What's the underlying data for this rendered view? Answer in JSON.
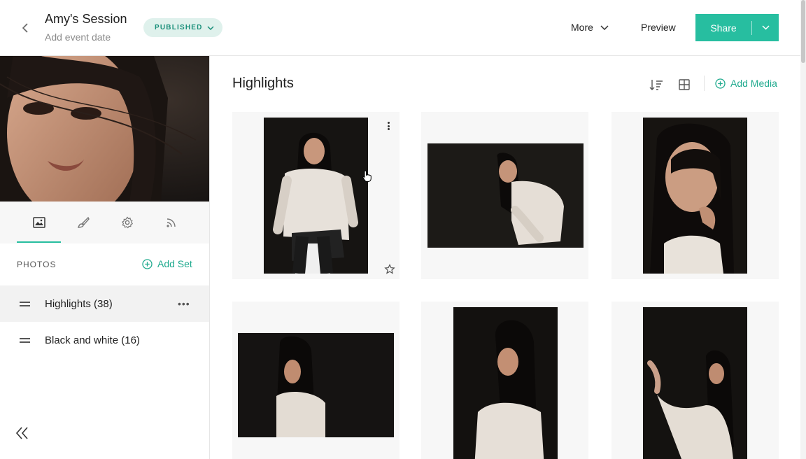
{
  "header": {
    "back_icon": "chevron-left-icon",
    "title": "Amy's Session",
    "subtitle": "Add event date",
    "status_label": "PUBLISHED",
    "more_label": "More",
    "preview_label": "Preview",
    "share_label": "Share"
  },
  "sidebar": {
    "tabs": [
      {
        "icon": "image-icon",
        "active": true
      },
      {
        "icon": "brush-icon",
        "active": false
      },
      {
        "icon": "gear-icon",
        "active": false
      },
      {
        "icon": "feed-icon",
        "active": false
      }
    ],
    "section_label": "PHOTOS",
    "add_set_label": "Add Set",
    "sets": [
      {
        "label": "Highlights (38)",
        "active": true
      },
      {
        "label": "Black and white (16)",
        "active": false
      }
    ]
  },
  "main": {
    "title": "Highlights",
    "add_media_label": "Add Media",
    "photos": [
      {
        "orientation": "portrait",
        "subject": "seated-woman-feather-jacket"
      },
      {
        "orientation": "landscape",
        "subject": "leaning-woman-feather-jacket"
      },
      {
        "orientation": "portrait",
        "subject": "close-up-hand-on-cheek"
      },
      {
        "orientation": "landscape",
        "subject": "profile-woman-dark-background"
      },
      {
        "orientation": "portrait",
        "subject": "profile-woman-looking-left"
      },
      {
        "orientation": "portrait",
        "subject": "woman-hand-raised"
      }
    ]
  },
  "colors": {
    "accent": "#27bea0",
    "accent_text": "#1faa8e",
    "status_bg": "#dff1ec",
    "tile_bg": "#f7f7f7"
  }
}
